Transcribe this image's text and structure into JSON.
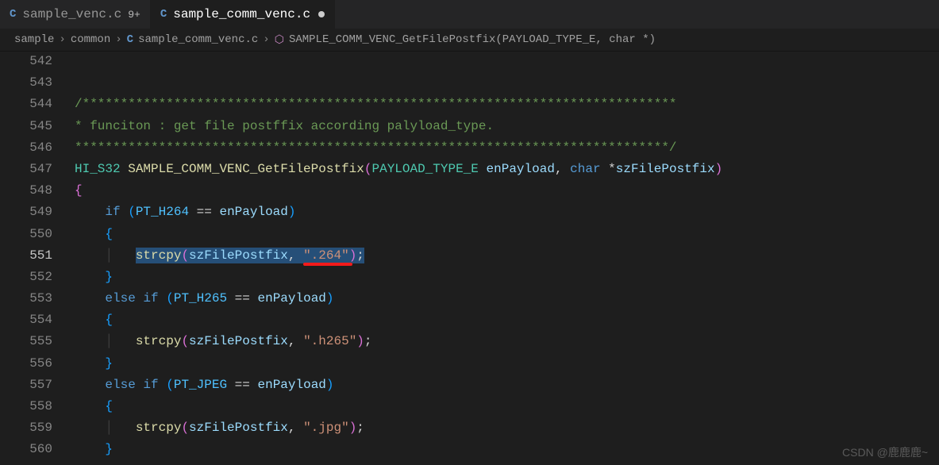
{
  "tabs": [
    {
      "icon": "C",
      "label": "sample_venc.c",
      "badge": "9+",
      "active": false,
      "modified": false
    },
    {
      "icon": "C",
      "label": "sample_comm_venc.c",
      "badge": "",
      "active": true,
      "modified": true
    }
  ],
  "breadcrumbs": {
    "seg1": "sample",
    "seg2": "common",
    "fileIcon": "C",
    "file": "sample_comm_venc.c",
    "symIcon": "⬡",
    "symbol": "SAMPLE_COMM_VENC_GetFilePostfix(PAYLOAD_TYPE_E, char *)"
  },
  "lineNumbers": [
    "542",
    "543",
    "544",
    "545",
    "546",
    "547",
    "548",
    "549",
    "550",
    "551",
    "552",
    "553",
    "554",
    "555",
    "556",
    "557",
    "558",
    "559",
    "560"
  ],
  "currentLine": "551",
  "code": {
    "c544": "/******************************************************************************",
    "c545_prefix": "* funciton : get file postffix according palyload_type.",
    "c546": "******************************************************************************/",
    "retType": "HI_S32",
    "funcName": "SAMPLE_COMM_VENC_GetFilePostfix",
    "paramType": "PAYLOAD_TYPE_E",
    "param1": "enPayload",
    "paramType2": "char",
    "param2": "szFilePostfix",
    "kw_if": "if",
    "kw_elseif": "else if",
    "const_h264": "PT_H264",
    "const_h265": "PT_H265",
    "const_jpeg": "PT_JPEG",
    "fn_strcpy": "strcpy",
    "var_postfix": "szFilePostfix",
    "var_payload": "enPayload",
    "str_264": "\".264\"",
    "str_h265": "\".h265\"",
    "str_jpg": "\".jpg\""
  },
  "watermark": "CSDN @鹿鹿鹿~"
}
